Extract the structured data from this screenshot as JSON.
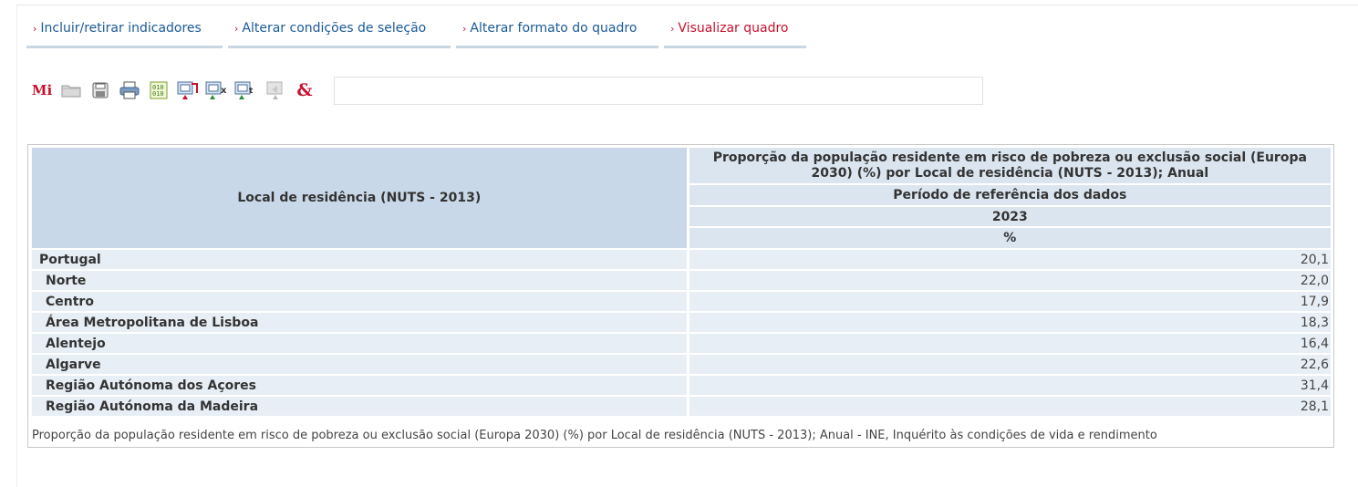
{
  "tabs": [
    {
      "label": "Incluir/retirar indicadores",
      "active": false
    },
    {
      "label": "Alterar condições de seleção",
      "active": false
    },
    {
      "label": "Alterar formato do quadro",
      "active": false
    },
    {
      "label": "Visualizar quadro",
      "active": true
    }
  ],
  "tab_chevron": "›",
  "toolbar": {
    "icons": [
      "my-ine-icon",
      "folder-icon",
      "save-icon",
      "print-icon",
      "csv-icon",
      "export-pdf-icon",
      "export-excel-icon",
      "export-text-icon",
      "share-icon",
      "link-icon"
    ],
    "mi_label": "Mi",
    "amp_label": "&",
    "url_value": ""
  },
  "table": {
    "row_header": "Local de residência (NUTS - 2013)",
    "col_title": "Proporção da população residente em risco de pobreza ou exclusão social (Europa 2030) (%) por Local de residência (NUTS - 2013); Anual",
    "col_period_label": "Período de referência dos dados",
    "col_year": "2023",
    "col_unit": "%",
    "rows": [
      {
        "name": "Portugal",
        "value": "20,1"
      },
      {
        "name": "Norte",
        "value": "22,0"
      },
      {
        "name": "Centro",
        "value": "17,9"
      },
      {
        "name": "Área Metropolitana de Lisboa",
        "value": "18,3"
      },
      {
        "name": "Alentejo",
        "value": "16,4"
      },
      {
        "name": "Algarve",
        "value": "22,6"
      },
      {
        "name": "Região Autónoma dos Açores",
        "value": "31,4"
      },
      {
        "name": "Região Autónoma da Madeira",
        "value": "28,1"
      }
    ],
    "source": "Proporção da população residente em risco de pobreza ou exclusão social (Europa 2030) (%) por Local de residência (NUTS - 2013); Anual - INE, Inquérito às condições de vida e rendimento"
  },
  "colors": {
    "accent_red": "#c8102e",
    "link_blue": "#1a5a96",
    "header_bg": "#c9d8e8",
    "row_bg": "#e8eef5"
  }
}
